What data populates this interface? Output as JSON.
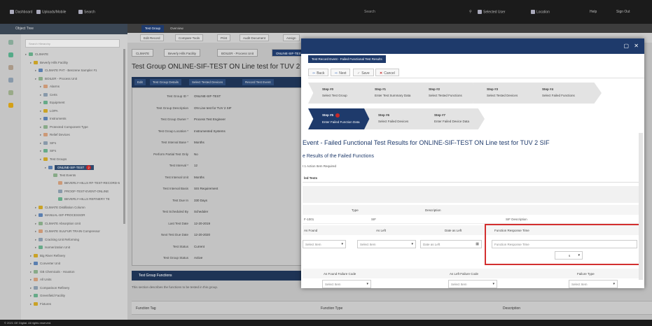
{
  "topbar": {
    "items": [
      "Dashboard",
      "Uploads/Mobile",
      "Search",
      "Selected User",
      "Location",
      "Help",
      "Sign Out"
    ],
    "search_placeholder": "Search"
  },
  "left": {
    "header": "Object Tree",
    "search_placeholder": "Search Hierarchy",
    "tree": [
      {
        "label": "CLIMATE",
        "depth": 0
      },
      {
        "label": "Beverly Hills Facility",
        "depth": 1
      },
      {
        "label": "CLIMATE PAT - Benzene Sampler #1",
        "depth": 2
      },
      {
        "label": "BOILER - Process Unit",
        "depth": 2
      },
      {
        "label": "Alarms",
        "depth": 3
      },
      {
        "label": "Certs",
        "depth": 3
      },
      {
        "label": "Equipment",
        "depth": 3
      },
      {
        "label": "LOPA",
        "depth": 3
      },
      {
        "label": "Instruments",
        "depth": 3
      },
      {
        "label": "Protected Component Type",
        "depth": 3
      },
      {
        "label": "Relief Devices",
        "depth": 3
      },
      {
        "label": "SIFs",
        "depth": 3
      },
      {
        "label": "SIFs",
        "depth": 3
      },
      {
        "label": "Test Groups",
        "depth": 3
      },
      {
        "label": "ONLINE-SIF-TEST",
        "depth": 4
      },
      {
        "label": "Test Events",
        "depth": 5
      },
      {
        "label": "BEVERLY-HILLS RF-TEST-RECORD-5",
        "depth": 6
      },
      {
        "label": "PROOF-TEST-EVENT-ONLINE",
        "depth": 6
      },
      {
        "label": "BEVERLY-HILLS REFINERY TE",
        "depth": 6
      },
      {
        "label": "CLIMATE Distillation Column",
        "depth": 2
      },
      {
        "label": "MANUAL-SIF-PROCESSOR",
        "depth": 2
      },
      {
        "label": "CLIMATE Absorption Unit",
        "depth": 2
      },
      {
        "label": "CLIMATE SULFUR TRAIN Compressor",
        "depth": 2
      },
      {
        "label": "Cracking Unit Reforming",
        "depth": 2
      },
      {
        "label": "Isomerization Unit",
        "depth": 2
      },
      {
        "label": "Big River Refinery",
        "depth": 1
      },
      {
        "label": "Converter Unit",
        "depth": 1
      },
      {
        "label": "GB Chemicals - Houston",
        "depth": 1
      },
      {
        "label": "All Units",
        "depth": 1
      },
      {
        "label": "Comparison Refinery",
        "depth": 1
      },
      {
        "label": "Greenfield Facility",
        "depth": 1
      },
      {
        "label": "Fixtures",
        "depth": 1
      }
    ],
    "selected_badge": "2"
  },
  "main": {
    "tabs": [
      "Test Group",
      "Overview"
    ],
    "toolbar": [
      "Edit Record",
      "Compare Tools",
      "Print",
      "Audit Document",
      "Assign"
    ],
    "crumbs": [
      "CLIMATE",
      "Beverly Hills Facility",
      "BOILER - Process Unit",
      "ONLINE-SIF-TEST"
    ],
    "title": "Test Group ONLINE-SIF-TEST ON Line test for TUV 2 SIF",
    "actions": [
      "Edit",
      "Test Group Details",
      "Select Tested Devices",
      "Record Test Event"
    ],
    "form": [
      {
        "label": "Test Group ID *",
        "value": "ONLINE-SIF-TEST"
      },
      {
        "label": "Test Group Description",
        "value": "ON Line test for TUV 2 SIF"
      },
      {
        "label": "Test Group Owner *",
        "value": "Process Test Engineer"
      },
      {
        "label": "Test Group Location *",
        "value": "Instrumented Systems"
      },
      {
        "label": "Test Interval Base *",
        "value": "Months"
      },
      {
        "label": "Perform Partial Test Only",
        "value": "No"
      },
      {
        "label": "Test Interval *",
        "value": "12"
      },
      {
        "label": "Test Interval Unit",
        "value": "Months"
      },
      {
        "label": "Test Interval Basis",
        "value": "SIS Requirement"
      },
      {
        "label": "Test Due In",
        "value": "330 Days"
      },
      {
        "label": "Test Scheduled By",
        "value": "Scheduler"
      },
      {
        "label": "Last Test Date",
        "value": "12-20-2019"
      },
      {
        "label": "Next Test Due Date",
        "value": "12-20-2020"
      },
      {
        "label": "Test Status",
        "value": "Current"
      },
      {
        "label": "Test Group Status",
        "value": "Active"
      }
    ],
    "func_bar": "Test Group Functions",
    "func_info": "This section describes the functions to be tested in this group.",
    "grid_cols": [
      "Function Tag",
      "Function Type",
      "Description"
    ]
  },
  "modal": {
    "tab": "Test Record Event - Failed Functional Test Results",
    "actions": [
      "Back",
      "Next",
      "Save",
      "Cancel"
    ],
    "steps": [
      {
        "num": "Step #0",
        "title": "Select Test Group"
      },
      {
        "num": "Step #1",
        "title": "Enter Test Summary Data"
      },
      {
        "num": "Step #2",
        "title": "Select Tested Functions"
      },
      {
        "num": "Step #3",
        "title": "Select Tested Devices"
      },
      {
        "num": "Step #4",
        "title": "Select Failed Functions"
      },
      {
        "num": "Step #5",
        "title": "Enter Failed Function Data"
      },
      {
        "num": "Step #6",
        "title": "Select Failed Devices"
      },
      {
        "num": "Step #7",
        "title": "Enter Failed Device Data"
      }
    ],
    "title": "Event - Failed Functional Test Results for ONLINE-SIF-TEST ON Line test for TUV 2 SIF",
    "subtitle": "e Results of the Failed Functions",
    "note": "t 1 Action Item Required",
    "section": "led Tests",
    "cols": [
      "Type",
      "Description"
    ],
    "row1": [
      "F-1001",
      "SIF",
      "SIF Description"
    ],
    "row2_cols": [
      "As Found",
      "As Left",
      "Date as Left",
      "Function Response Time"
    ],
    "row3": {
      "as_found": "Select Item",
      "as_left": "Select Item",
      "date_placeholder": "Date as Left",
      "resp_placeholder": "Function Response Time",
      "unit": "s"
    },
    "row4_cols": [
      "As Found Failure Code",
      "As Left Failure Code",
      "Failure Type"
    ],
    "row5": [
      "Select Item",
      "Select Item",
      "Select Item"
    ]
  },
  "footer": "© 2021 GE Digital. All rights reserved."
}
